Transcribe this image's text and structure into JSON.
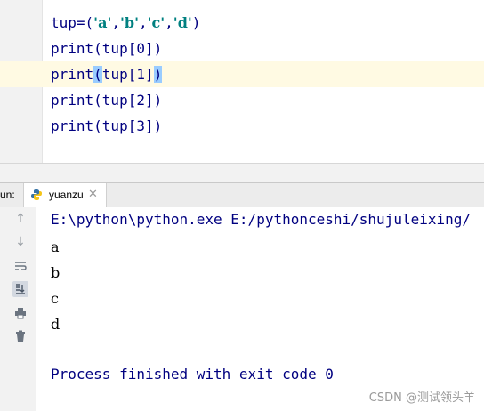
{
  "editor": {
    "line1": {
      "pre": "tup=(",
      "s1": "'a'",
      "c1": ",",
      "s2": "'b'",
      "c2": ",",
      "s3": "'c'",
      "c3": ",",
      "s4": "'d'",
      "post": ")"
    },
    "line2": "print(tup[0])",
    "line3_pre": "print",
    "line3_open": "(",
    "line3_mid": "tup[1]",
    "line3_close": ")",
    "line4": "print(tup[2])",
    "line5": "print(tup[3])"
  },
  "run": {
    "label": "un:",
    "tab_label": "yuanzu",
    "tab_icon": "python-icon"
  },
  "console": {
    "command": "E:\\python\\python.exe E:/pythonceshi/shujuleixing/",
    "output": [
      "a",
      "b",
      "c",
      "d"
    ],
    "exit_message": "Process finished with exit code 0"
  },
  "watermark": "CSDN @测试领头羊",
  "colors": {
    "keyword_text": "#000080",
    "string_text": "#008080",
    "brace_highlight": "#99ccff",
    "current_line": "#fffae3"
  }
}
